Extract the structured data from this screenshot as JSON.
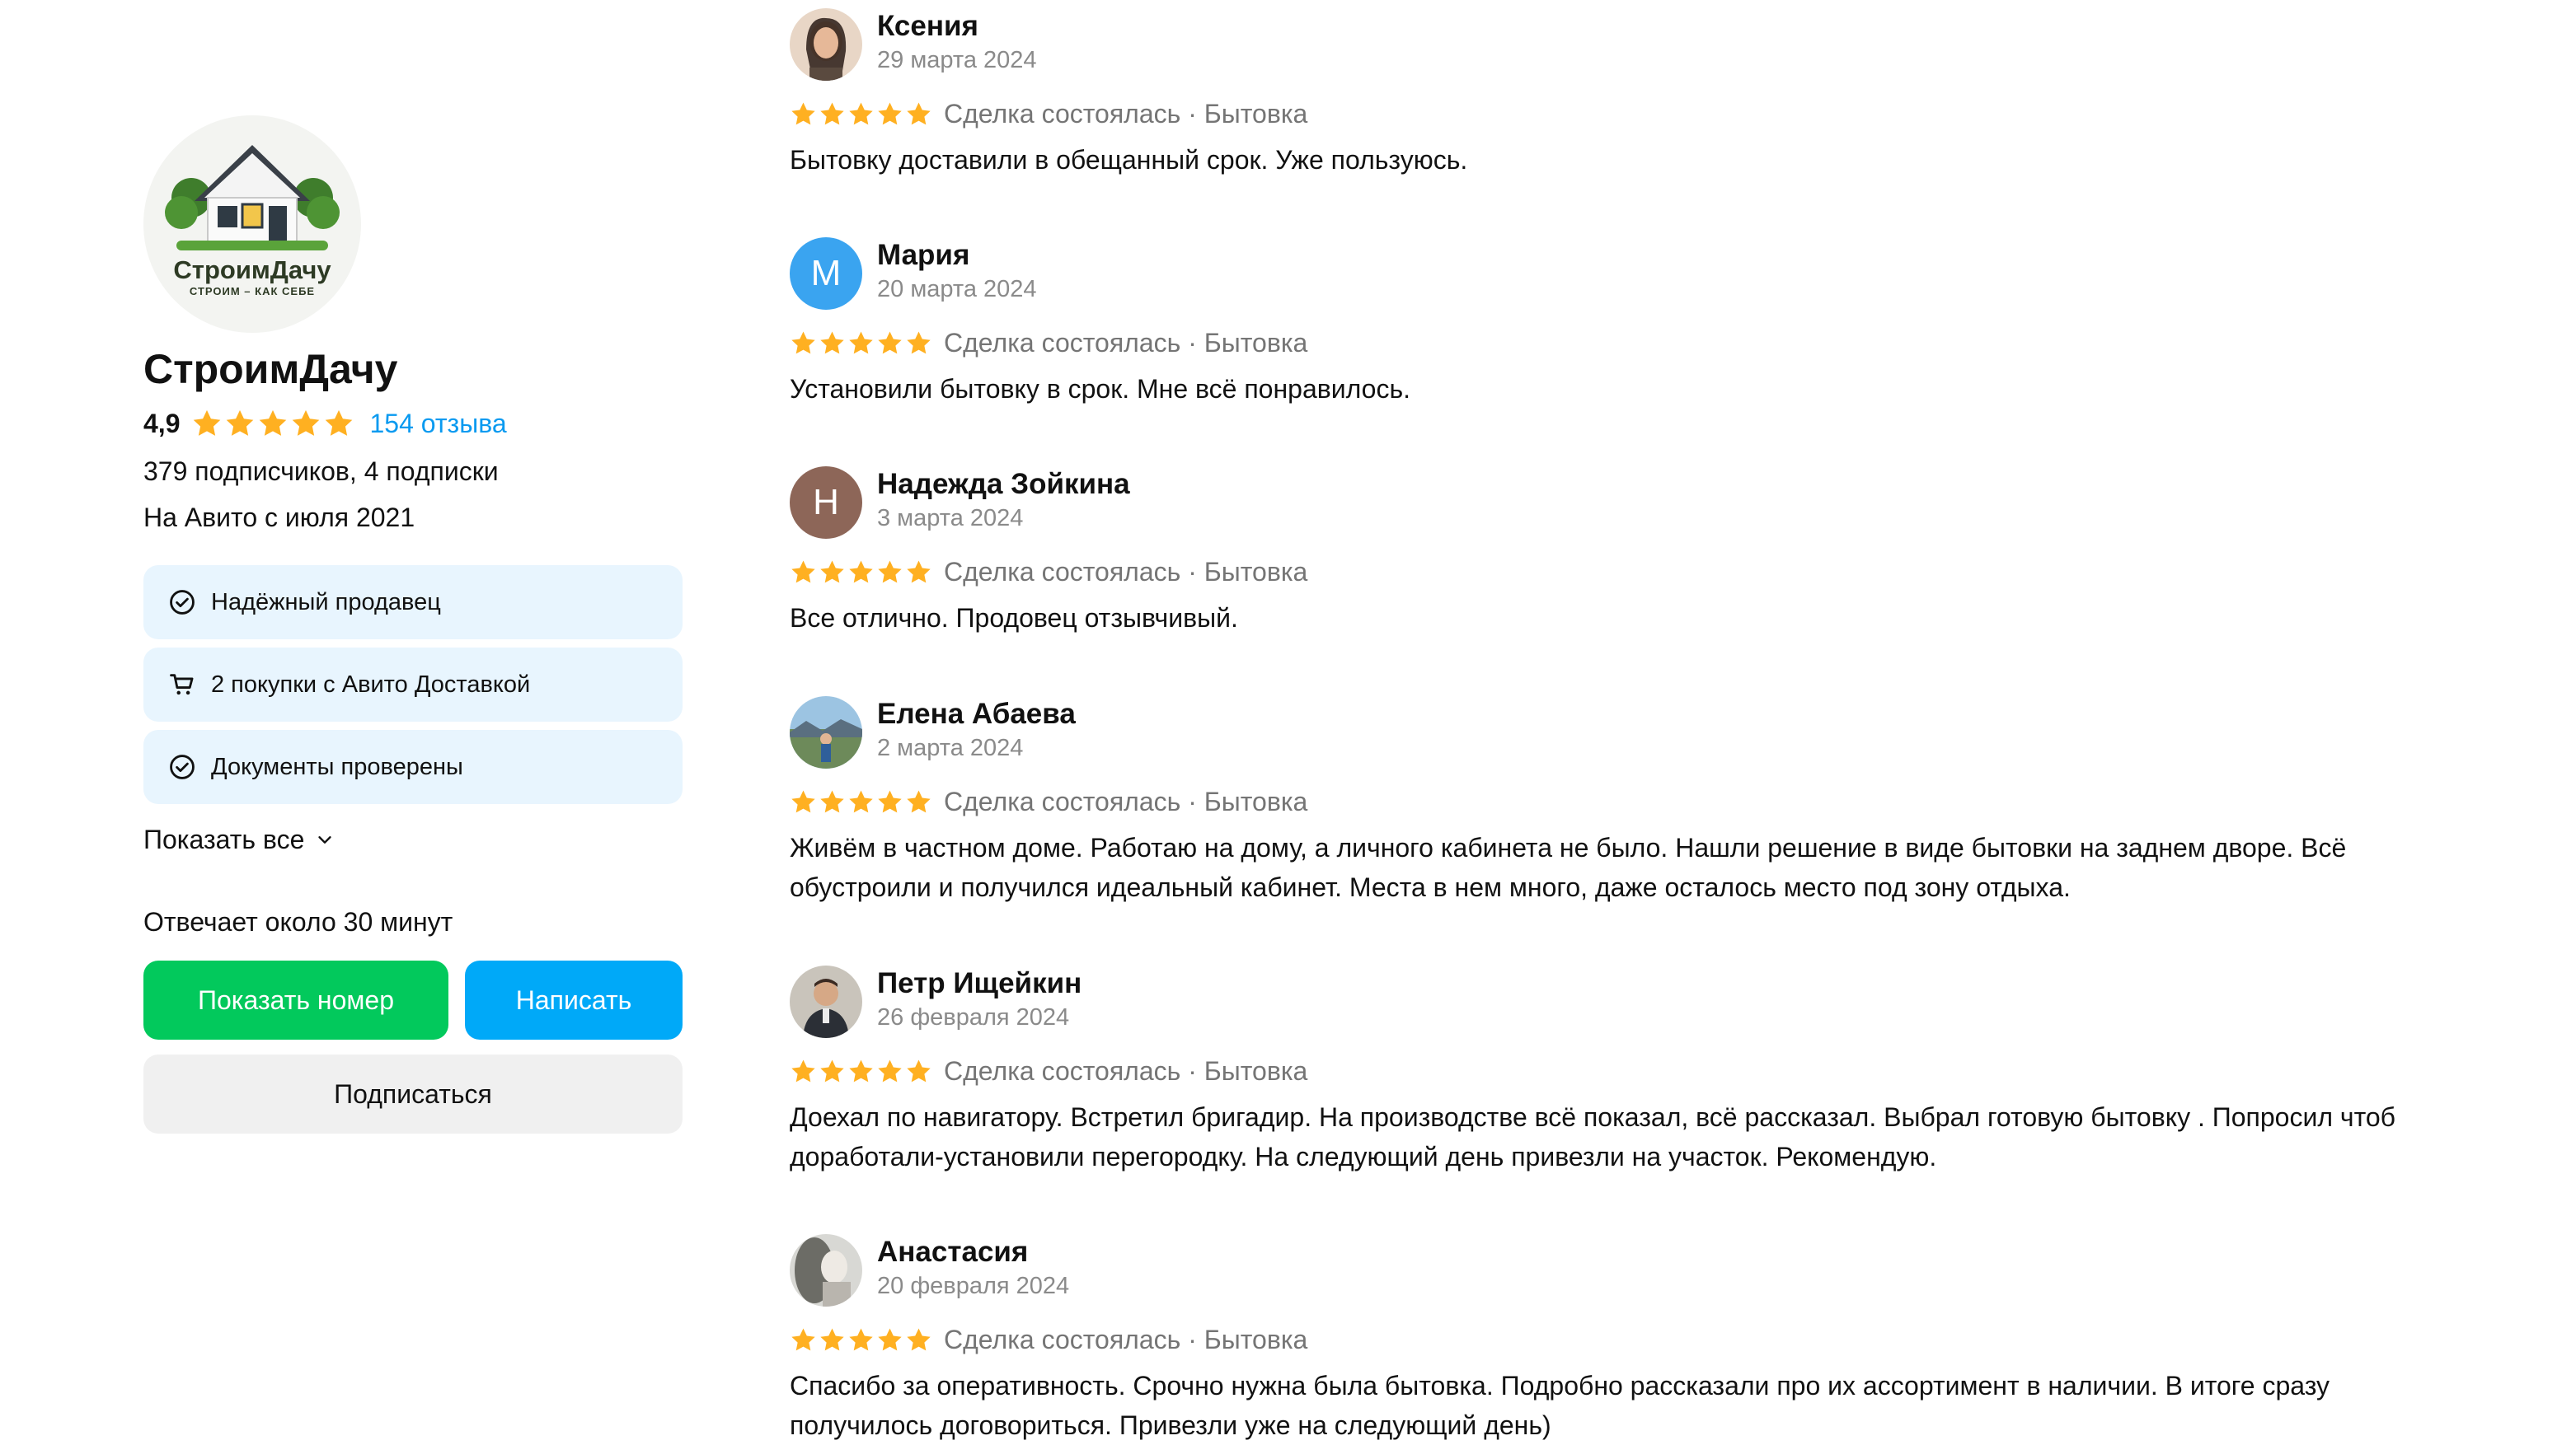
{
  "seller": {
    "logo_name": "СтроимДачу",
    "logo_tagline": "СТРОИМ – КАК СЕБЕ",
    "name": "СтроимДачу",
    "rating": "4,9",
    "stars": 5,
    "reviews_link": "154 отзыва",
    "followers": "379 подписчиков, 4 подписки",
    "since": "На Авито с июля 2021",
    "badges": [
      {
        "icon": "check-circle-icon",
        "label": "Надёжный продавец"
      },
      {
        "icon": "cart-icon",
        "label": "2 покупки с Авито Доставкой"
      },
      {
        "icon": "check-circle-icon",
        "label": "Документы проверены"
      }
    ],
    "show_all": "Показать все",
    "response_time": "Отвечает около 30 минут",
    "show_phone_button": "Показать номер",
    "write_button": "Написать",
    "subscribe_button": "Подписаться"
  },
  "colors": {
    "accent_blue": "#00a9f8",
    "accent_green": "#02c95c",
    "star": "#ffb021",
    "badge_bg": "#e8f5fe"
  },
  "reviews": [
    {
      "name": "Ксения",
      "date": "29 марта 2024",
      "stars": 5,
      "deal": "Сделка состоялась · Бытовка",
      "text": "Бытовку доставили в обещанный срок. Уже пользуюсь.",
      "avatar": "photo"
    },
    {
      "name": "Мария",
      "date": "20 марта 2024",
      "stars": 5,
      "deal": "Сделка состоялась · Бытовка",
      "text": "Установили бытовку в срок. Мне всё понравилось.",
      "avatar": "letter",
      "initial": "М",
      "avatar_color": "#3aa4f0"
    },
    {
      "name": "Надежда Зойкина",
      "date": "3 марта 2024",
      "stars": 5,
      "deal": "Сделка состоялась · Бытовка",
      "text": "Все отлично. Продовец отзывчивый.",
      "avatar": "letter",
      "initial": "Н",
      "avatar_color": "#8d6658"
    },
    {
      "name": "Елена Абаева",
      "date": "2 марта 2024",
      "stars": 5,
      "deal": "Сделка состоялась · Бытовка",
      "text": "Живём в частном доме. Работаю на дому, а личного кабинета не было. Нашли решение в виде бытовки на заднем дворе. Всё обустроили и получился идеальный кабинет. Места в нем много, даже осталось место под зону отдыха.",
      "avatar": "photo"
    },
    {
      "name": "Петр Ищейкин",
      "date": "26 февраля 2024",
      "stars": 5,
      "deal": "Сделка состоялась · Бытовка",
      "text": "Доехал по навигатору. Встретил бригадир. На производстве всё показал, всё рассказал. Выбрал готовую бытовку . Попросил чтоб доработали-установили перегородку. На следующий день привезли на участок. Рекомендую.",
      "avatar": "photo"
    },
    {
      "name": "Анастасия",
      "date": "20 февраля 2024",
      "stars": 5,
      "deal": "Сделка состоялась · Бытовка",
      "text": "Спасибо за оперативность. Срочно нужна была бытовка. Подробно рассказали про их ассортимент в наличии. В итоге сразу получилось договориться. Привезли уже на следующий день)",
      "avatar": "photo"
    }
  ]
}
